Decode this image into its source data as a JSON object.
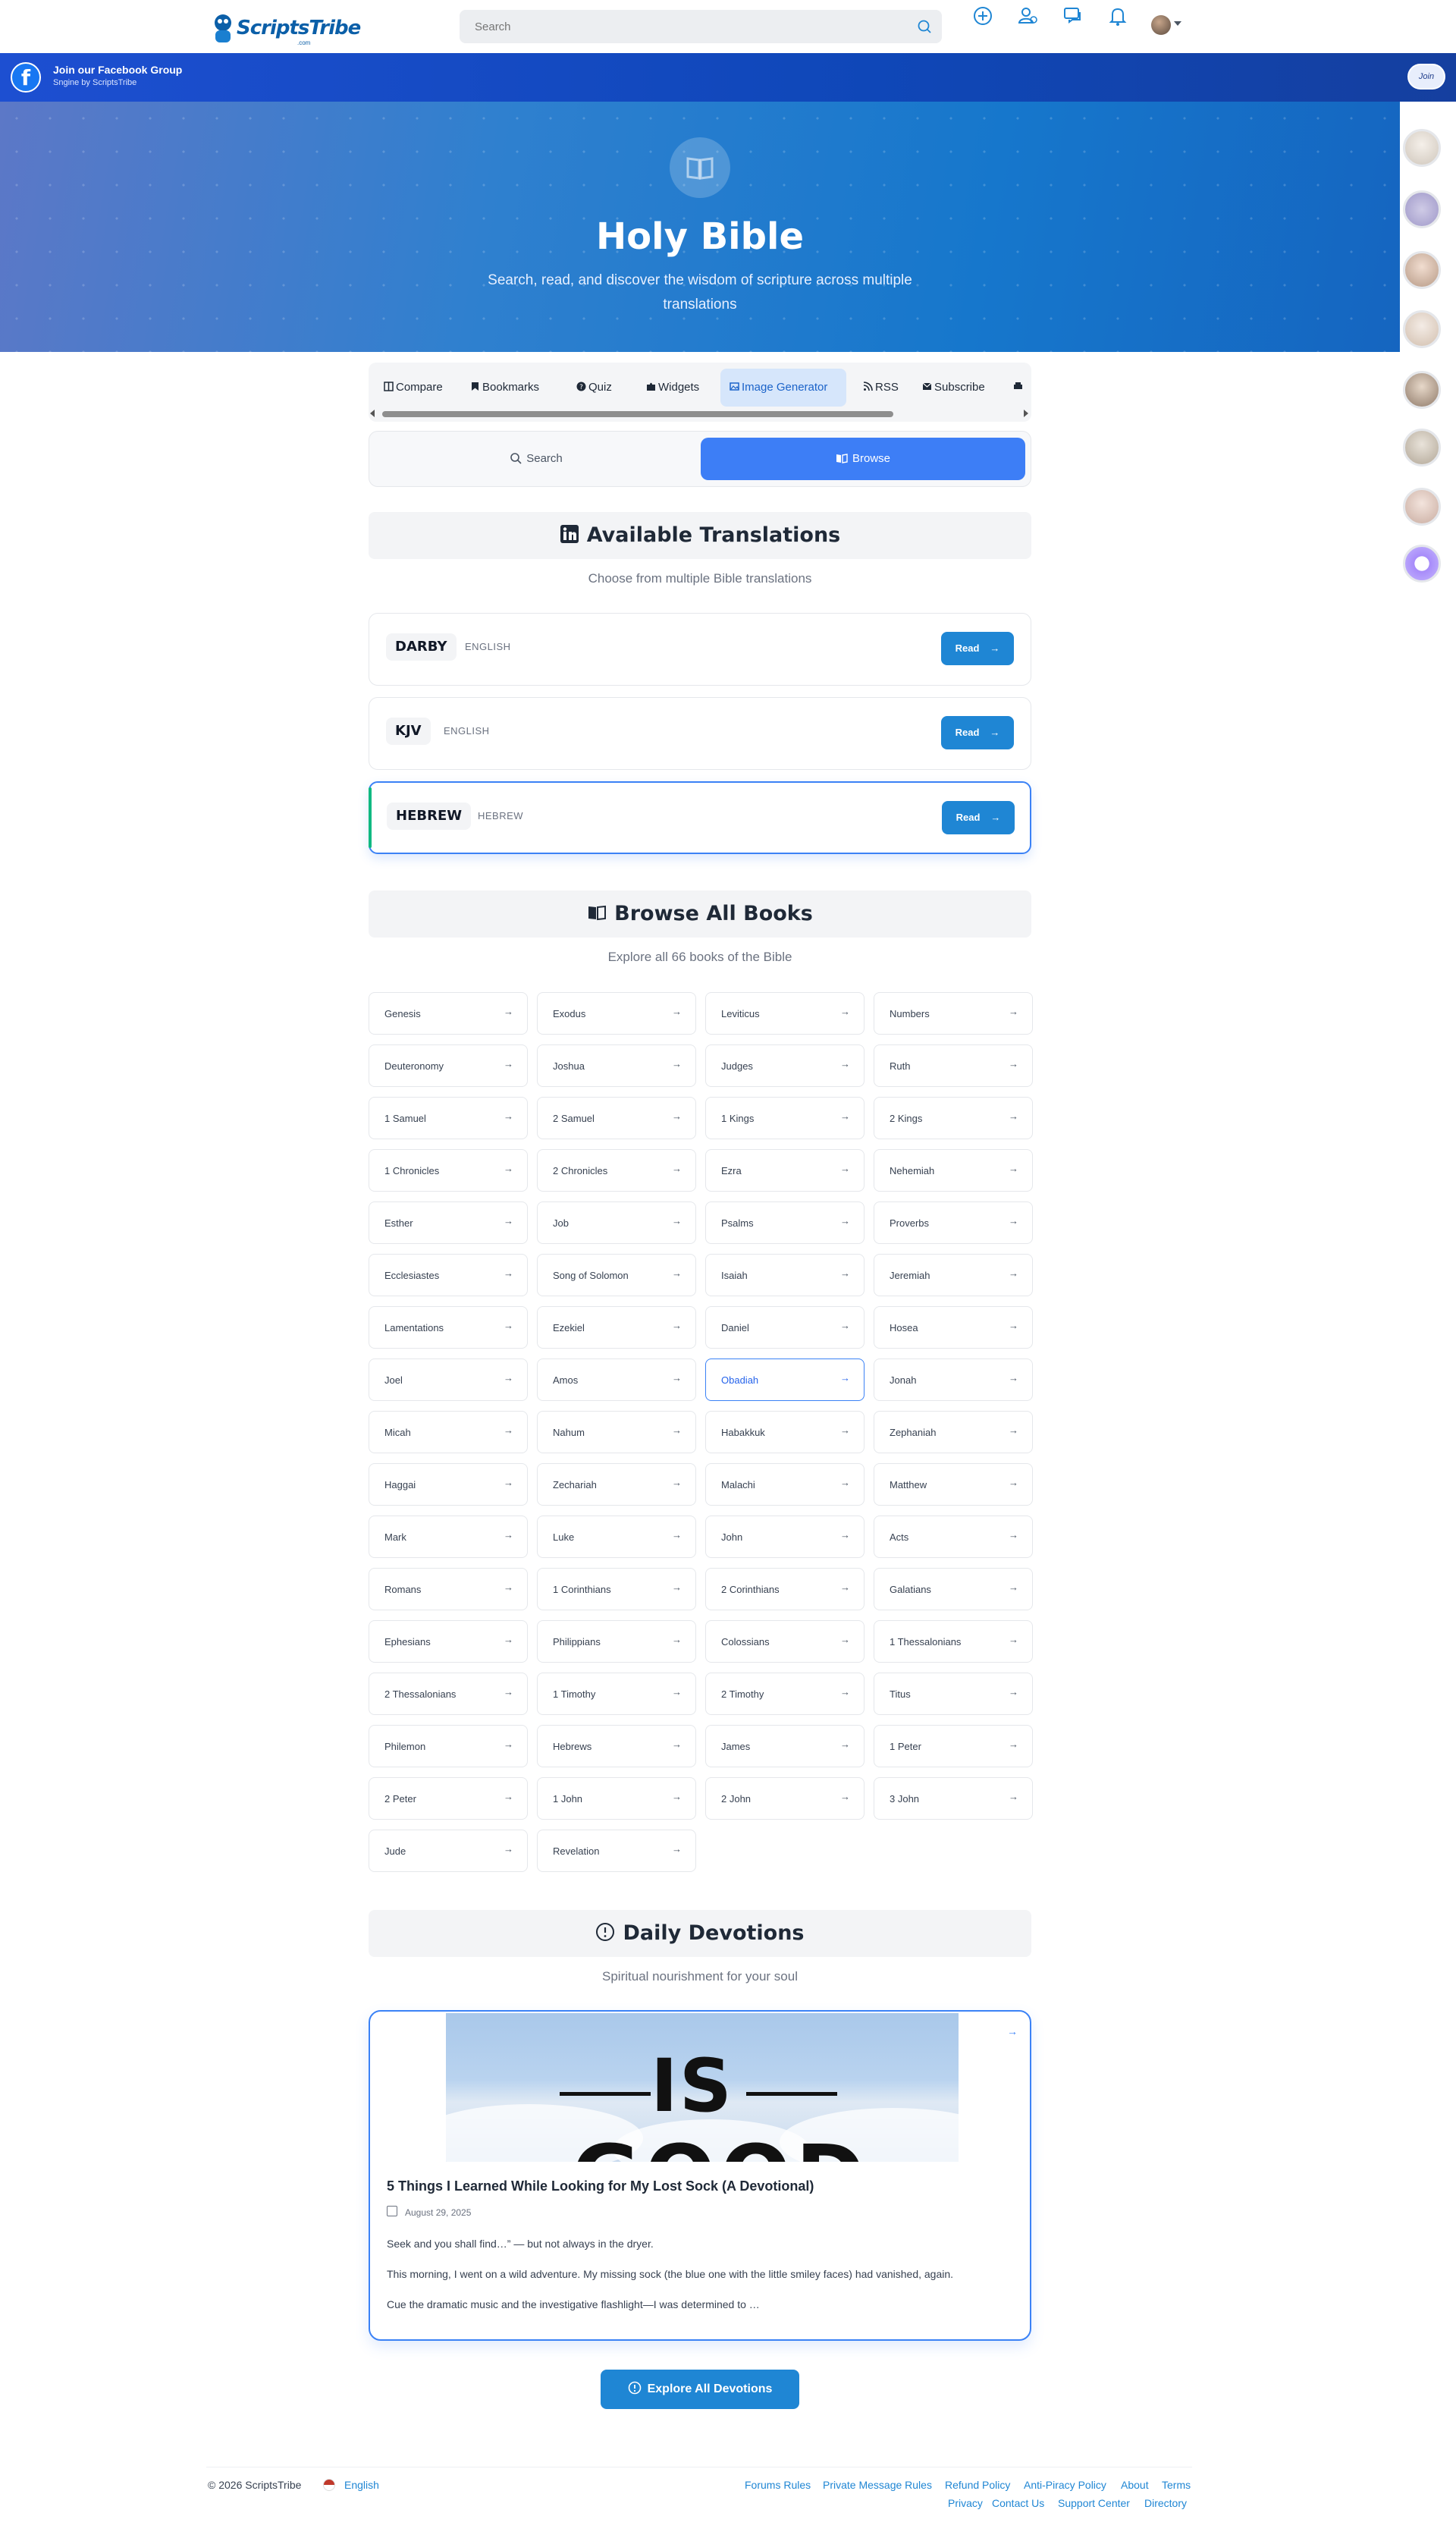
{
  "header": {
    "logo_text": "ScriptsTribe",
    "logo_sub": ".com",
    "search_placeholder": "Search"
  },
  "facebook_bar": {
    "title": "Join our Facebook Group",
    "subtitle": "Sngine by ScriptsTribe",
    "join_label": "Join"
  },
  "hero": {
    "title": "Holy Bible",
    "description": "Search, read, and discover the wisdom of scripture across multiple translations"
  },
  "tabs": [
    {
      "label": "Compare",
      "icon": "compare-icon"
    },
    {
      "label": "Bookmarks",
      "icon": "bookmark-icon"
    },
    {
      "label": "Quiz",
      "icon": "question-icon"
    },
    {
      "label": "Widgets",
      "icon": "puzzle-icon"
    },
    {
      "label": "Image Generator",
      "icon": "image-icon"
    },
    {
      "label": "RSS",
      "icon": "rss-icon"
    },
    {
      "label": "Subscribe",
      "icon": "mail-icon"
    }
  ],
  "toggle": {
    "search_label": "Search",
    "browse_label": "Browse"
  },
  "translations_section": {
    "title": "Available Translations",
    "subtitle": "Choose from multiple Bible translations",
    "items": [
      {
        "name": "DARBY",
        "language": "ENGLISH",
        "read_label": "Read"
      },
      {
        "name": "KJV",
        "language": "ENGLISH",
        "read_label": "Read"
      },
      {
        "name": "HEBREW",
        "language": "HEBREW",
        "read_label": "Read"
      }
    ]
  },
  "books_section": {
    "title": "Browse All Books",
    "subtitle": "Explore all 66 books of the Bible",
    "arrow": "→",
    "highlighted": "Obadiah",
    "books": [
      "Genesis",
      "Exodus",
      "Leviticus",
      "Numbers",
      "Deuteronomy",
      "Joshua",
      "Judges",
      "Ruth",
      "1 Samuel",
      "2 Samuel",
      "1 Kings",
      "2 Kings",
      "1 Chronicles",
      "2 Chronicles",
      "Ezra",
      "Nehemiah",
      "Esther",
      "Job",
      "Psalms",
      "Proverbs",
      "Ecclesiastes",
      "Song of Solomon",
      "Isaiah",
      "Jeremiah",
      "Lamentations",
      "Ezekiel",
      "Daniel",
      "Hosea",
      "Joel",
      "Amos",
      "Obadiah",
      "Jonah",
      "Micah",
      "Nahum",
      "Habakkuk",
      "Zephaniah",
      "Haggai",
      "Zechariah",
      "Malachi",
      "Matthew",
      "Mark",
      "Luke",
      "John",
      "Acts",
      "Romans",
      "1 Corinthians",
      "2 Corinthians",
      "Galatians",
      "Ephesians",
      "Philippians",
      "Colossians",
      "1 Thessalonians",
      "2 Thessalonians",
      "1 Timothy",
      "2 Timothy",
      "Titus",
      "Philemon",
      "Hebrews",
      "James",
      "1 Peter",
      "2 Peter",
      "1 John",
      "2 John",
      "3 John",
      "Jude",
      "Revelation"
    ]
  },
  "devotions_section": {
    "title": "Daily Devotions",
    "subtitle": "Spiritual nourishment for your soul",
    "card": {
      "image_text_is": "IS",
      "image_text_good": "GOOD",
      "title": "5 Things I Learned While Looking for My Lost Sock (A Devotional)",
      "date": "August 29, 2025",
      "p1": "Seek and you shall find…” — but not always in the dryer.",
      "p2": "This morning, I went on a wild adventure. My missing sock (the blue one with the little smiley faces) had vanished, again.",
      "p3": "Cue the dramatic music and the investigative flashlight—I was determined to …"
    },
    "explore_label": "Explore All Devotions"
  },
  "footer": {
    "copyright": "© 2026 ScriptsTribe",
    "language": "English",
    "links_row1": [
      "Forums Rules",
      "Private Message Rules",
      "Refund Policy",
      "Anti-Piracy Policy",
      "About",
      "Terms"
    ],
    "links_row2": [
      "Privacy",
      "Contact Us",
      "Support Center",
      "Directory"
    ]
  },
  "colors": {
    "primary": "#1f86d4",
    "accent": "#3d7ef6",
    "highlight_border": "#3b82f6",
    "left_stripe": "#10b981"
  }
}
